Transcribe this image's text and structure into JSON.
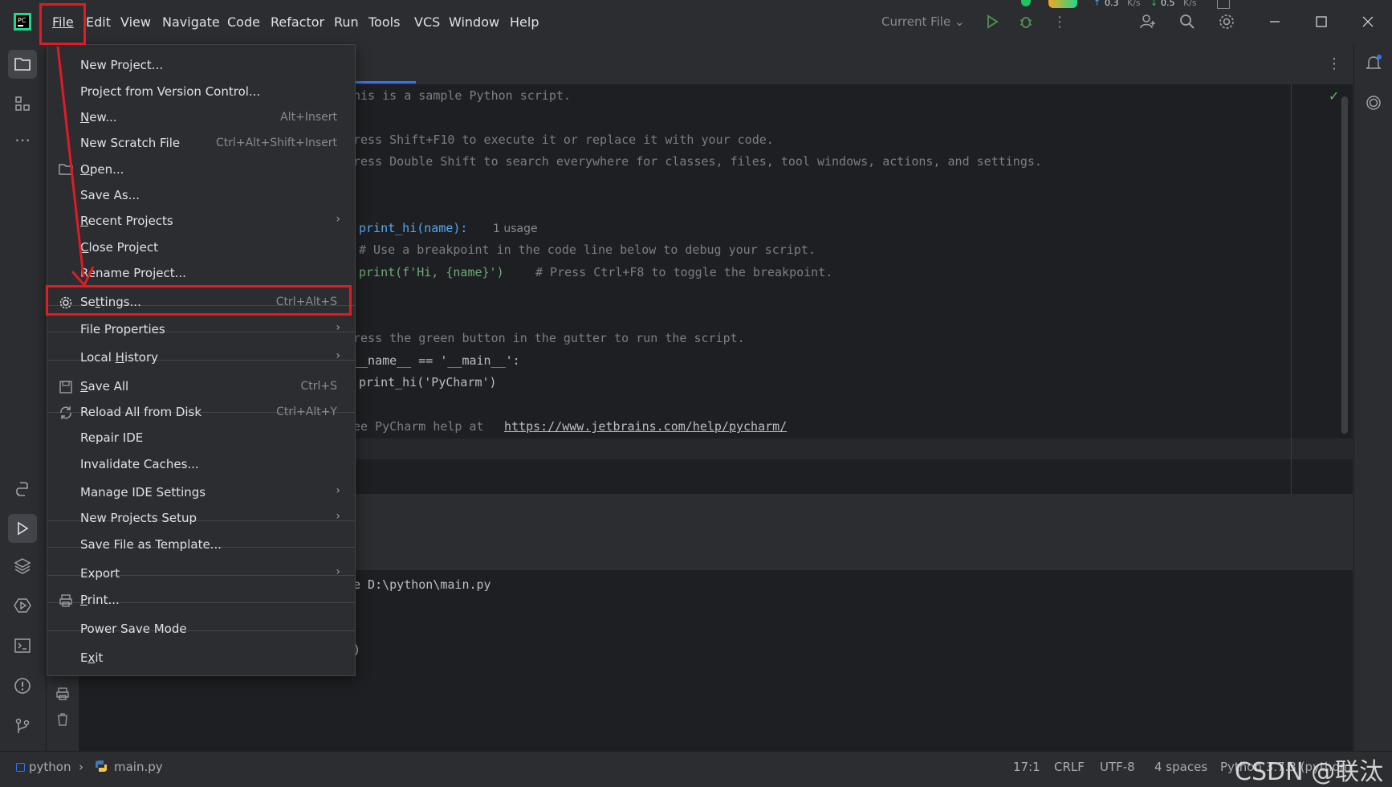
{
  "menubar": {
    "items": [
      {
        "label": "File"
      },
      {
        "label": "Edit"
      },
      {
        "label": "View"
      },
      {
        "label": "Navigate"
      },
      {
        "label": "Code"
      },
      {
        "label": "Refactor"
      },
      {
        "label": "Run"
      },
      {
        "label": "Tools"
      },
      {
        "label": "VCS"
      },
      {
        "label": "Window"
      },
      {
        "label": "Help"
      }
    ],
    "run_config": "Current File",
    "net_up": "0.3",
    "net_up_unit": "K/s",
    "net_down": "0.5",
    "net_down_unit": "K/s"
  },
  "file_menu": {
    "items": [
      {
        "label": "New Project...",
        "shortcut": ""
      },
      {
        "label": "Project from Version Control...",
        "shortcut": ""
      },
      {
        "label": "New...",
        "shortcut": "Alt+Insert"
      },
      {
        "label": "New Scratch File",
        "shortcut": "Ctrl+Alt+Shift+Insert"
      },
      {
        "label": "Open...",
        "shortcut": ""
      },
      {
        "label": "Save As...",
        "shortcut": ""
      },
      {
        "label": "Recent Projects",
        "shortcut": ""
      },
      {
        "label": "Close Project",
        "shortcut": ""
      },
      {
        "label": "Rename Project...",
        "shortcut": ""
      },
      {
        "label": "Settings...",
        "shortcut": "Ctrl+Alt+S"
      },
      {
        "label": "File Properties",
        "shortcut": ""
      },
      {
        "label": "Local History",
        "shortcut": ""
      },
      {
        "label": "Save All",
        "shortcut": "Ctrl+S"
      },
      {
        "label": "Reload All from Disk",
        "shortcut": "Ctrl+Alt+Y"
      },
      {
        "label": "Repair IDE",
        "shortcut": ""
      },
      {
        "label": "Invalidate Caches...",
        "shortcut": ""
      },
      {
        "label": "Manage IDE Settings",
        "shortcut": ""
      },
      {
        "label": "New Projects Setup",
        "shortcut": ""
      },
      {
        "label": "Save File as Template...",
        "shortcut": ""
      },
      {
        "label": "Export",
        "shortcut": ""
      },
      {
        "label": "Print...",
        "shortcut": ""
      },
      {
        "label": "Power Save Mode",
        "shortcut": ""
      },
      {
        "label": "Exit",
        "shortcut": ""
      }
    ]
  },
  "editor": {
    "lines": [
      "his is a sample Python script.",
      "ress Shift+F10 to execute it or replace it with your code.",
      "ress Double Shift to search everywhere for classes, files, tool windows, actions, and settings.",
      "print_hi(name):",
      "1 usage",
      "# Use a breakpoint in the code line below to debug your script.",
      "print(f'Hi, {name}')",
      "# Press Ctrl+F8 to toggle the breakpoint.",
      "ress the green button in the gutter to run the script.",
      "__name__ == '__main__':",
      "print_hi('PyCharm')",
      "ee PyCharm help at",
      "https://www.jetbrains.com/help/pycharm/"
    ],
    "run_output_1": "e D:\\python\\main.py",
    "run_output_2": ")"
  },
  "statusbar": {
    "project": "python",
    "file": "main.py",
    "position": "17:1",
    "line_sep": "CRLF",
    "encoding": "UTF-8",
    "indent": "4 spaces",
    "interpreter": "Python 3.7.3 (python)",
    "watermark": "CSDN @联汰"
  },
  "colors": {
    "accent_red": "#e01b24",
    "bg_editor": "#1e1f22",
    "bg_panel": "#2b2d30"
  }
}
